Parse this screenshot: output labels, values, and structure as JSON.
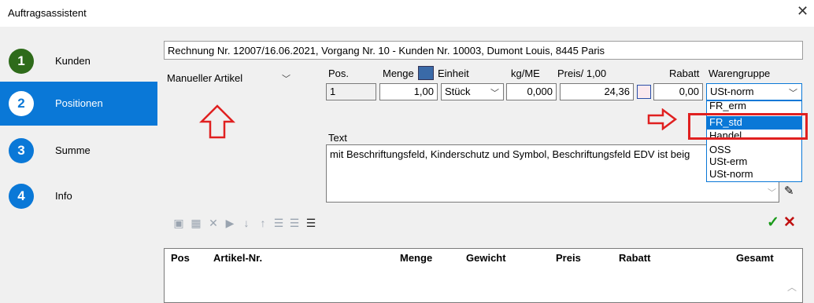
{
  "window": {
    "title": "Auftragsassistent"
  },
  "sidebar": {
    "steps": [
      {
        "num": "1",
        "label": "Kunden",
        "color": "#2e6b1a"
      },
      {
        "num": "2",
        "label": "Positionen",
        "color": "#0a78d7"
      },
      {
        "num": "3",
        "label": "Summe",
        "color": "#0a78d7"
      },
      {
        "num": "4",
        "label": "Info",
        "color": "#0a78d7"
      }
    ]
  },
  "header": {
    "info": "Rechnung Nr. 12007/16.06.2021, Vorgang Nr. 10 - Kunden Nr. 10003, Dumont Louis, 8445 Paris"
  },
  "article_type": {
    "value": "Manueller Artikel"
  },
  "fields": {
    "pos_label": "Pos.",
    "pos_value": "1",
    "menge_label": "Menge",
    "menge_value": "1,00",
    "einheit_label": "Einheit",
    "einheit_value": "Stück",
    "kgme_label": "kg/ME",
    "kgme_value": "0,000",
    "preis_label": "Preis/ 1,00",
    "preis_value": "24,36",
    "rabatt_label": "Rabatt",
    "rabatt_value": "0,00",
    "warengruppe_label": "Warengruppe",
    "warengruppe_value": "USt-norm"
  },
  "dropdown": {
    "options": [
      "FR_erm",
      "FR_std",
      "Handel",
      "OSS",
      "USt-erm",
      "USt-norm"
    ],
    "selected": "FR_std"
  },
  "text_section": {
    "label": "Text",
    "value": "mit Beschriftungsfeld, Kinderschutz und Symbol, Beschriftungsfeld EDV ist beig"
  },
  "table": {
    "columns": [
      "Pos",
      "Artikel-Nr.",
      "Menge",
      "Gewicht",
      "Preis",
      "Rabatt",
      "Gesamt"
    ]
  },
  "colors": {
    "accent": "#0a78d7",
    "annotation": "#e02020",
    "ok": "#1a9a1a"
  }
}
